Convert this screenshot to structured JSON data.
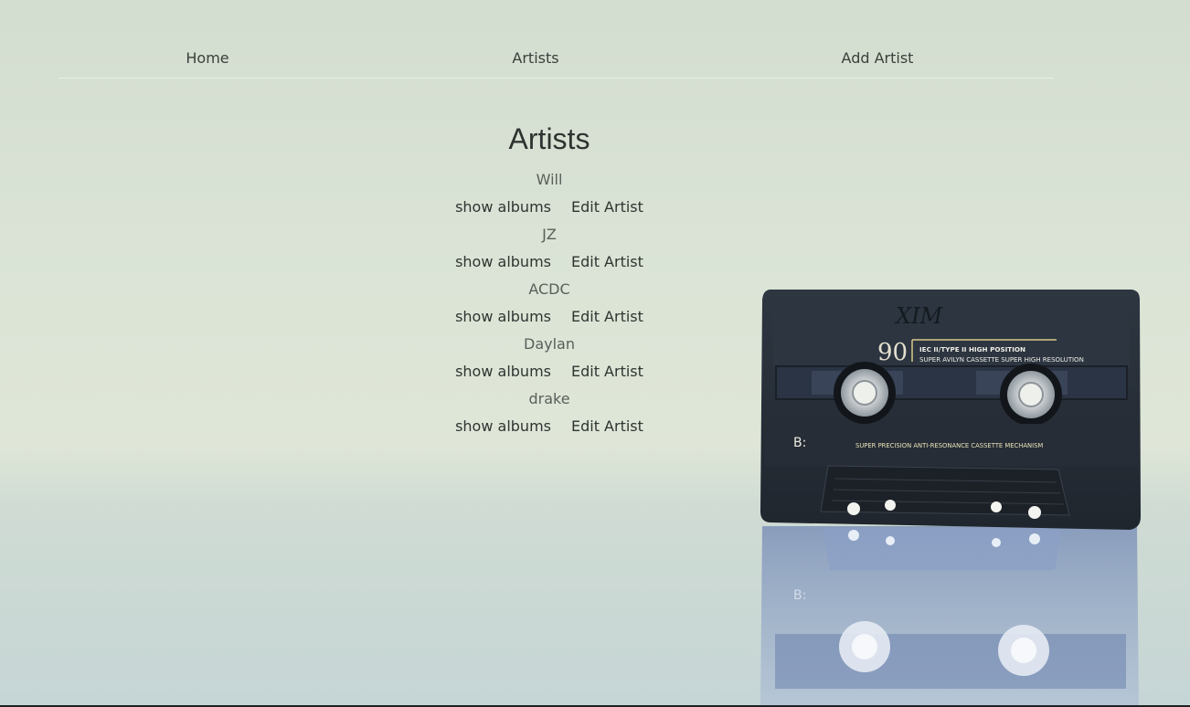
{
  "nav": {
    "home": "Home",
    "artists": "Artists",
    "add_artist": "Add Artist"
  },
  "page": {
    "title": "Artists"
  },
  "artists": [
    {
      "name": "Will",
      "show_albums": "show albums",
      "edit": "Edit Artist"
    },
    {
      "name": "JZ",
      "show_albums": "show albums",
      "edit": "Edit Artist"
    },
    {
      "name": "ACDC",
      "show_albums": "show albums",
      "edit": "Edit Artist"
    },
    {
      "name": "Daylan",
      "show_albums": "show albums",
      "edit": "Edit Artist"
    },
    {
      "name": "drake",
      "show_albums": "show albums",
      "edit": "Edit Artist"
    }
  ],
  "cassette": {
    "handwriting": "XIM",
    "length": "90",
    "type_line": "IEC II/TYPE II HIGH POSITION",
    "brand_line": "SUPER AVILYN CASSETTE SUPER HIGH RESOLUTION",
    "side": "B:",
    "mechanism_line": "SUPER PRECISION ANTI-RESONANCE CASSETTE MECHANISM"
  },
  "colors": {
    "background": "#dbe4d6",
    "text": "#3a3d3a",
    "cassette_body": "#2a313a"
  }
}
